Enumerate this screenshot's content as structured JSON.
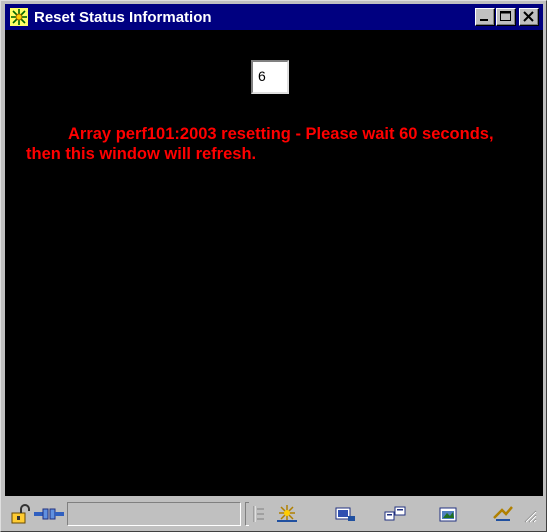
{
  "window": {
    "title": "Reset Status Information",
    "title_icon": "netscape-star-icon",
    "controls": [
      "minimize-icon",
      "maximize-icon",
      "close-icon"
    ]
  },
  "content": {
    "counter_value": "6",
    "message": "Array perf101:2003 resetting - Please wait 60 seconds, then this window will refresh.",
    "message_color": "#ff0000",
    "background_color": "#000000"
  },
  "statusbar": {
    "status_text": "",
    "icons": [
      "security-lock-icon",
      "connection-icon",
      "progress-field",
      "component-bar-handle-icon",
      "navigator-icon",
      "mail-icon",
      "discussions-icon",
      "composer-icon",
      "conference-icon"
    ]
  },
  "colors": {
    "titlebar": "#000080",
    "chrome": "#c0c0c0"
  }
}
